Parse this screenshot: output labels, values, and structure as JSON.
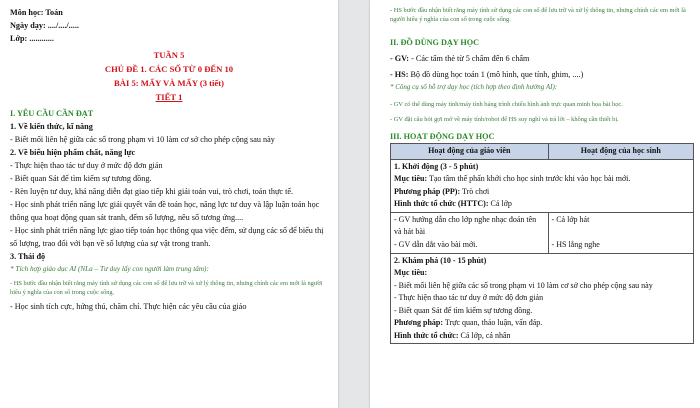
{
  "left": {
    "subject": "Môn học: Toán",
    "date": "Ngày dạy: ..../..../.....",
    "class": "Lớp: ............",
    "week": "TUẦN 5",
    "topic": "CHỦ ĐỀ 1. CÁC SỐ TỪ 0 ĐẾN 10",
    "lesson": "BÀI 5: MẤY VÀ MẤY (3 tiết)",
    "period": "TIẾT 1",
    "h1": "I. YÊU CẦU CẦN ĐẠT",
    "h1_1": "1. Về kiến thức, kĩ năng",
    "p1": "- Biết mối liên hệ giữa các số trong phạm vi 10 làm cơ sở cho phép cộng sau này",
    "h1_2": "2. Về biểu hiện phẩm chất, năng lực",
    "p2": "- Thực hiện thao tác tư duy ở mức độ đơn giản",
    "p3": "- Biết quan Sát để tìm kiếm sự tương đồng.",
    "p4": "- Rèn luyện tư duy, khả năng diễn đạt giao tiếp khi giải toán vui, trò chơi, toán thực tế.",
    "p5": "- Học sinh phát triển năng lực giải quyết vấn đề toán học, năng lực tư duy và lập luận toán học thông qua hoạt động quan sát tranh, đếm số lượng, nêu số tương ứng....",
    "p6": "- Học sinh phát triển năng lực giao tiếp toán học thông qua việc đếm, sử dụng các số để biểu thị số lượng, trao đổi với bạn về số lượng của sự vật trong tranh.",
    "h1_3": "3. Thái độ",
    "ai_note": "* Tích hợp giáo dục AI (NLa – Tư duy lấy con người làm trung tâm):",
    "ai_p": "- HS bước đầu nhận biết rằng máy tính sử dụng các con số để lưu trữ và xử lý thông tin, nhưng chính các em mới là người hiểu ý nghĩa của con số trong cuộc sống.",
    "p7": "- Học sinh tích cực, hứng thú, chăm chỉ. Thực hiện các yêu cầu của giáo"
  },
  "right": {
    "top_note": "- HS bước đầu nhận biết rằng máy tính sử dụng các con số để lưu trữ và xử lý thông tin, nhưng chính các em mới là người hiểu ý nghĩa của con số trong cuộc sống.",
    "h2": "II. ĐỒ DÙNG DẠY HỌC",
    "gv_label": "- GV:",
    "gv_text": " - Các tấm thẻ từ 5 chấm đến 6 chấm",
    "hs_label": "- HS:",
    "hs_text": " Bộ đồ dùng học toán 1 (mô hình, que tính, ghim, ....)",
    "ai_tools": "* Công cụ số hỗ trợ dạy học (tích hợp theo định hướng AI):",
    "ai_tool1": "- GV có thể dùng máy tính/máy tính bảng trình chiếu hình ảnh trực quan minh họa bài học.",
    "ai_tool2": "- GV đặt câu hỏi gợi mở về máy tính/robot để HS suy nghĩ và trả lời – không cần thiết bị.",
    "h3": "III. HOẠT ĐỘNG DẠY HỌC",
    "col_teacher": "Hoạt động của giáo viên",
    "col_student": "Hoạt động của học sinh",
    "s1_title": "1. Khởi động (3 - 5 phút)",
    "s1_goal_label": "Mục tiêu:",
    "s1_goal": " Tạo tâm thế phấn khởi cho học sinh trước khi vào học bài mới.",
    "s1_method_label": "Phương pháp (PP):",
    "s1_method": " Trò chơi",
    "s1_org_label": "Hình thức tổ chức (HTTC):",
    "s1_org": " Cá lớp",
    "s1_t1": "- GV hướng dẫn cho lớp nghe nhạc đoán tên và hát bài",
    "s1_s1": "- Cả lớp hát",
    "s1_t2": "- GV dẫn dắt vào bài mới.",
    "s1_s2": "- HS lắng nghe",
    "s2_title": "2. Khám phá (10 - 15 phút)",
    "s2_goal_label": "Mục tiêu:",
    "s2_b1": "- Biết mối liên hệ giữa các số trong phạm vi 10 làm cơ sở cho phép cộng sau này",
    "s2_b2": "- Thực hiện thao tác tư duy ở mức độ đơn giản",
    "s2_b3": "- Biết quan Sát để tìm kiếm sự tương đồng.",
    "s2_method_label": "Phương pháp:",
    "s2_method": " Trực quan, thảo luận, vấn đáp.",
    "s2_org_label": "Hình thức tổ chức:",
    "s2_org": " Cá lớp, cá nhân"
  }
}
